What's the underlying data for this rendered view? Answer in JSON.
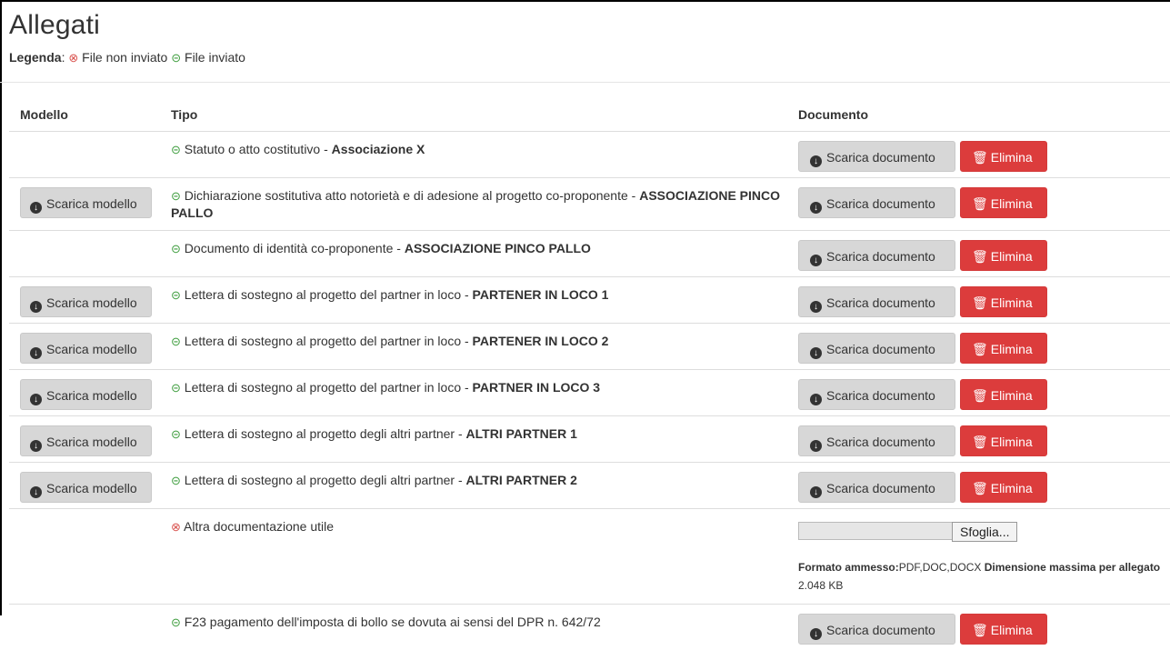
{
  "title": "Allegati",
  "legend": {
    "label": "Legenda",
    "not_sent": "File non inviato",
    "sent": "File inviato"
  },
  "table": {
    "headers": [
      "Modello",
      "Tipo",
      "Documento"
    ],
    "buttons": {
      "model": "Scarica modello",
      "doc": "Scarica documento",
      "delete": "Elimina"
    },
    "rows": [
      {
        "model": false,
        "status": "ok",
        "text": "Statuto o atto costitutivo - ",
        "bold": "Associazione X",
        "doc": "buttons"
      },
      {
        "model": true,
        "status": "ok",
        "text": "Dichiarazione sostitutiva atto notorietà e di adesione al progetto co-proponente - ",
        "bold": "ASSOCIAZIONE PINCO PALLO",
        "doc": "buttons"
      },
      {
        "model": false,
        "status": "ok",
        "text": "Documento di identità co-proponente - ",
        "bold": "ASSOCIAZIONE PINCO PALLO",
        "doc": "buttons"
      },
      {
        "model": true,
        "status": "ok",
        "text": "Lettera di sostegno al progetto del partner in loco - ",
        "bold": "PARTENER IN LOCO 1",
        "doc": "buttons"
      },
      {
        "model": true,
        "status": "ok",
        "text": "Lettera di sostegno al progetto del partner in loco - ",
        "bold": "PARTENER IN LOCO 2",
        "doc": "buttons"
      },
      {
        "model": true,
        "status": "ok",
        "text": "Lettera di sostegno al progetto del partner in loco - ",
        "bold": "PARTNER IN LOCO 3",
        "doc": "buttons"
      },
      {
        "model": true,
        "status": "ok",
        "text": "Lettera di sostegno al progetto degli altri partner - ",
        "bold": "ALTRI PARTNER 1",
        "doc": "buttons"
      },
      {
        "model": true,
        "status": "ok",
        "text": "Lettera di sostegno al progetto degli altri partner - ",
        "bold": "ALTRI PARTNER 2",
        "doc": "buttons"
      },
      {
        "model": false,
        "status": "ko",
        "text": "Altra documentazione utile",
        "bold": "",
        "doc": "upload"
      },
      {
        "model": false,
        "status": "ok",
        "text": "F23 pagamento dell'imposta di bollo se dovuta ai sensi del DPR n. 642/72",
        "bold": "",
        "doc": "buttons"
      }
    ],
    "upload": {
      "browse": "Sfoglia...",
      "format_label": "Formato ammesso:",
      "format_value": "PDF,DOC,DOCX",
      "size_label": "Dimensione massima per allegato",
      "size_value": "2.048 KB"
    }
  },
  "colors": {
    "ok": "#3c9c3c",
    "ko": "#d9534f",
    "delete_button": "#dc3c3c",
    "gray_button": "#d7d7d7"
  },
  "icons": {
    "ok": "check-circle-icon",
    "ko": "times-circle-icon",
    "download": "download-circle-icon",
    "delete": "trash-icon"
  }
}
